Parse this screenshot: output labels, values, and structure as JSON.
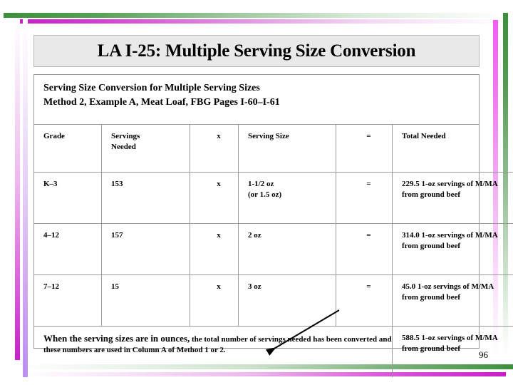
{
  "slide": {
    "title": "LA I-25: Multiple Serving Size Conversion",
    "page_number": "96",
    "subtitle_line_1": "Serving Size Conversion for Multiple Serving Sizes",
    "subtitle_line_2": "Method 2, Example A, Meat Loaf, FBG Pages I-60–I-61"
  },
  "table": {
    "columns": [
      "Grade",
      "Servings Needed",
      "x",
      "Serving Size",
      "=",
      "Total Needed"
    ],
    "header": {
      "grade": "Grade",
      "servings_needed_line_1": "Servings",
      "servings_needed_line_2": "Needed",
      "times": "x",
      "serving_size": "Serving Size",
      "equals": "=",
      "total_needed": "Total Needed"
    },
    "rows": [
      {
        "grade": "K–3",
        "servings_needed": "153",
        "times": "x",
        "serving_size_line_1": "1-1/2 oz",
        "serving_size_line_2": "(or 1.5 oz)",
        "equals": "=",
        "total_line_1": "229.5 1-oz servings of M/MA",
        "total_line_2": "from ground beef"
      },
      {
        "grade": "4–12",
        "servings_needed": "157",
        "times": "x",
        "serving_size_line_1": "2 oz",
        "serving_size_line_2": "",
        "equals": "=",
        "total_line_1": "314.0 1-oz servings of M/MA",
        "total_line_2": "from ground beef"
      },
      {
        "grade": "7–12",
        "servings_needed": "15",
        "times": "x",
        "serving_size_line_1": "3 oz",
        "serving_size_line_2": "",
        "equals": "=",
        "total_line_1": "45.0 1-oz servings of M/MA",
        "total_line_2": "from ground beef"
      }
    ],
    "footer": {
      "note_bold": "When the serving sizes are in ounces,",
      "note_rest": " the total number of servings needed has been converted and these numbers are used in Column A of Method 1 or 2.",
      "total_line_1": "588.5 1-oz servings of M/MA",
      "total_line_2": "from ground beef"
    }
  },
  "annotations": {
    "arrow": "diagonal-arrow-pointing-down-left"
  },
  "colors": {
    "green": "#3c8f3c",
    "magenta": "#c71fc7",
    "violet": "#bb8ef0",
    "title_background": "#e9e9e9",
    "table_border": "#9a9a9a",
    "text": "#000000"
  }
}
